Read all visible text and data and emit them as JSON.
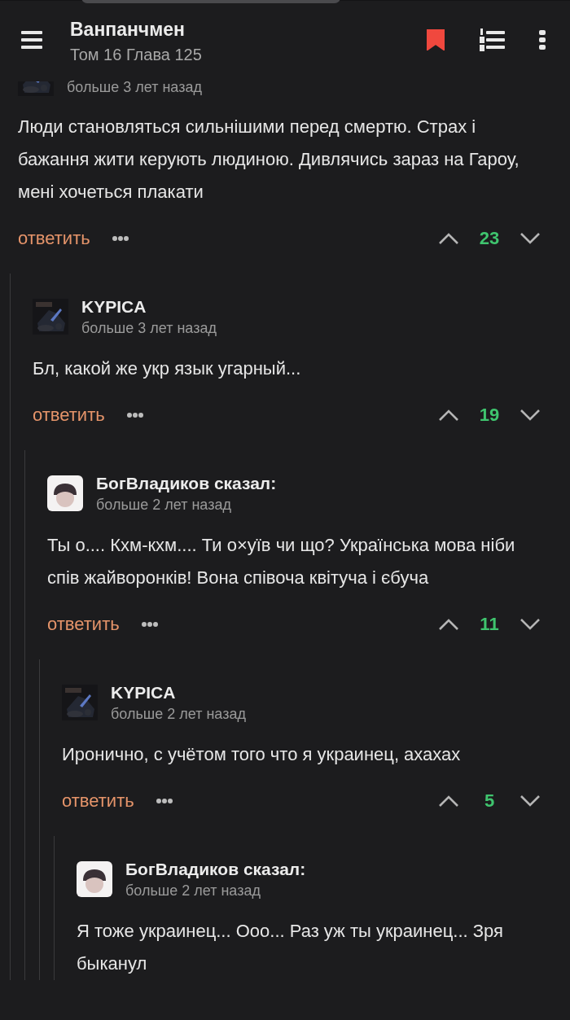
{
  "header": {
    "title": "Ванпанчмен",
    "subtitle": "Том 16 Глава 125",
    "bookmarked": true
  },
  "comments": [
    {
      "time": "больше 3 лет назад",
      "text": "Люди становляться сильнішими перед смертю. Страх і бажання жити керують людиною. Дивлячись зараз на Гароу, мені хочеться плакати",
      "reply": "ответить",
      "votes": "23",
      "children": [
        {
          "author": "KYPICA",
          "time": "больше 3 лет назад",
          "text": "Бл, какой же укр язык угарный...",
          "reply": "ответить",
          "votes": "19",
          "children": [
            {
              "avatar": {
                "kind": "avatar"
              },
              "author": "БогВладиков сказал:",
              "time": "больше 2 лет назад",
              "text": "Ты о.... Кхм-кхм.... Ти о×уїв чи що? Українська мова ніби спів жайворонків! Вона співоча квітуча і єбуча",
              "reply": "ответить",
              "votes": "11",
              "children": [
                {
                  "author": "KYPICA",
                  "time": "больше 2 лет назад",
                  "text": "Иронично, с учётом того что я украинец, ахахах",
                  "reply": "ответить",
                  "votes": "5",
                  "children": [
                    {
                      "avatar": {
                        "kind": "avatar"
                      },
                      "author": "БогВладиков сказал:",
                      "time": "больше 2 лет назад",
                      "text": "Я тоже украинец... Ооо... Раз уж ты украинец... Зря быканул"
                    }
                  ]
                }
              ]
            }
          ]
        }
      ]
    }
  ]
}
